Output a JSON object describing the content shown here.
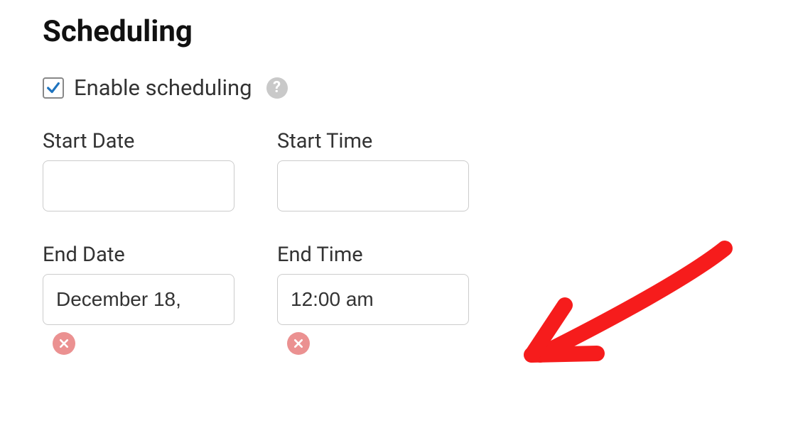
{
  "heading": "Scheduling",
  "enable": {
    "label": "Enable scheduling",
    "checked": true
  },
  "fields": {
    "startDate": {
      "label": "Start Date",
      "value": ""
    },
    "startTime": {
      "label": "Start Time",
      "value": ""
    },
    "endDate": {
      "label": "End Date",
      "value": "December 18,"
    },
    "endTime": {
      "label": "End Time",
      "value": "12:00 am"
    }
  },
  "colors": {
    "check": "#1e73be",
    "clear": "#eb9191",
    "arrow": "#f61c1c"
  }
}
